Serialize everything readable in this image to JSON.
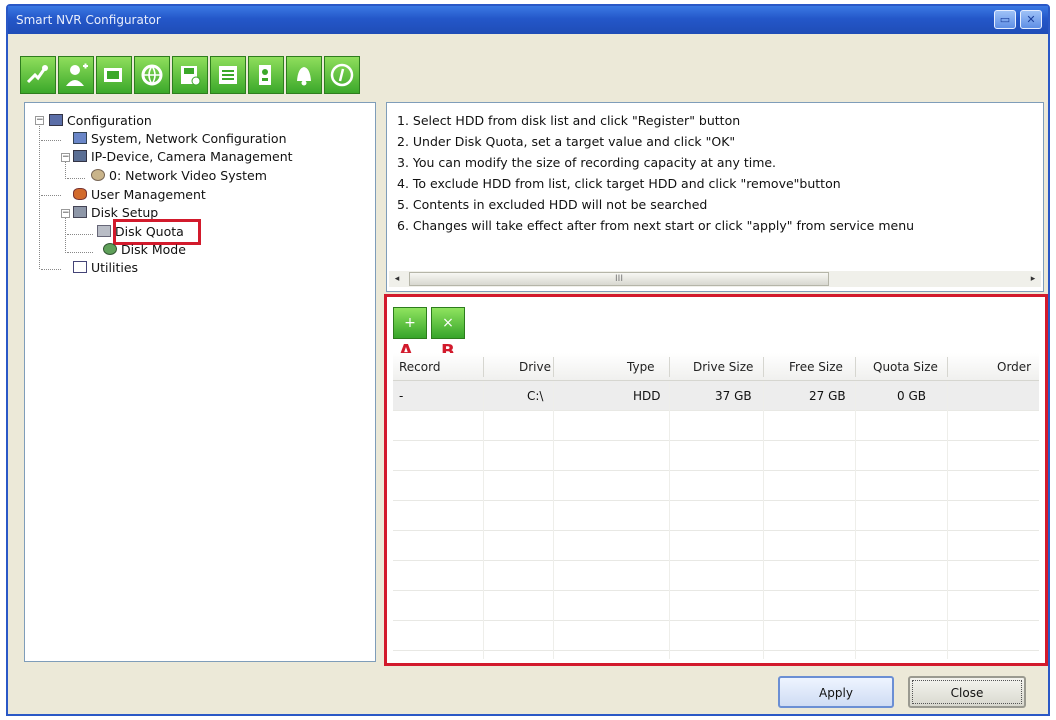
{
  "window": {
    "title": "Smart NVR Configurator",
    "minimize_glyph": "▭",
    "close_glyph": "✕"
  },
  "toolbar": {
    "tools": [
      {
        "icon": "network-tools-icon"
      },
      {
        "icon": "user-add-icon"
      },
      {
        "icon": "camera-icon"
      },
      {
        "icon": "globe-icon"
      },
      {
        "icon": "disk-save-icon"
      },
      {
        "icon": "list-icon"
      },
      {
        "icon": "device-icon"
      },
      {
        "icon": "bell-icon"
      },
      {
        "icon": "info-icon"
      }
    ]
  },
  "tree": {
    "root": "Configuration",
    "system_network": "System, Network Configuration",
    "ip_device": "IP-Device, Camera Management",
    "network_video_system": "0: Network Video System",
    "user_management": "User Management",
    "disk_setup": "Disk Setup",
    "disk_quota": "Disk Quota",
    "disk_mode": "Disk Mode",
    "utilities": "Utilities",
    "expand_minus": "−",
    "expand_plus": "+"
  },
  "instructions": [
    "1. Select HDD from disk list and click \"Register\" button",
    "2. Under Disk Quota, set a target value and click \"OK\"",
    "3. You can modify the size of recording capacity at any time.",
    "4. To exclude HDD from list, click target HDD and click \"remove\"button",
    "5. Contents in excluded HDD will not be searched",
    "6. Changes will take effect after from next start or click \"apply\" from service menu"
  ],
  "scroll": {
    "left_arrow": "◂",
    "right_arrow": "▸",
    "thumb_grip": "III"
  },
  "quota": {
    "label_a": "A",
    "label_b": "B",
    "register_glyph": "+",
    "remove_glyph": "×",
    "columns": [
      "Record",
      "Drive",
      "Type",
      "Drive Size",
      "Free Size",
      "Quota Size",
      "Order"
    ],
    "rows": [
      [
        "-",
        "C:\\",
        "HDD",
        "37 GB",
        "27 GB",
        "0 GB",
        ""
      ]
    ]
  },
  "buttons": {
    "apply": "Apply",
    "close": "Close"
  }
}
